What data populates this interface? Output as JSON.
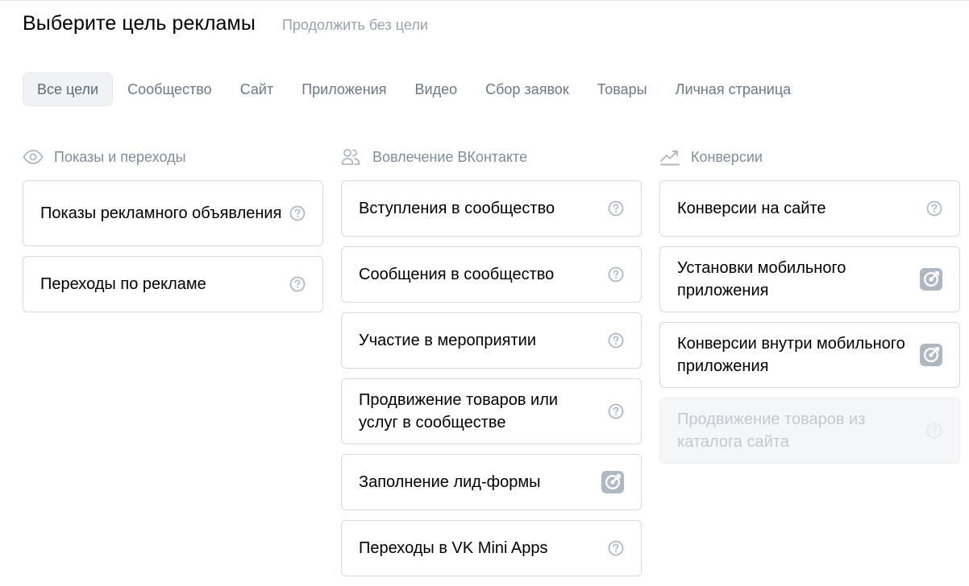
{
  "header": {
    "title": "Выберите цель рекламы",
    "skip_link": "Продолжить без цели"
  },
  "tabs": [
    {
      "label": "Все цели",
      "active": true
    },
    {
      "label": "Сообщество",
      "active": false
    },
    {
      "label": "Сайт",
      "active": false
    },
    {
      "label": "Приложения",
      "active": false
    },
    {
      "label": "Видео",
      "active": false
    },
    {
      "label": "Сбор заявок",
      "active": false
    },
    {
      "label": "Товары",
      "active": false
    },
    {
      "label": "Личная страница",
      "active": false
    }
  ],
  "columns": [
    {
      "title": "Показы и переходы",
      "icon": "eye-icon",
      "cards": [
        {
          "label": "Показы рекламного объявления",
          "badge": "question-circle-icon",
          "disabled": false
        },
        {
          "label": "Переходы по рекламе",
          "badge": "question-circle-icon",
          "disabled": false
        }
      ]
    },
    {
      "title": "Вовлечение ВКонтакте",
      "icon": "users-icon",
      "cards": [
        {
          "label": "Вступления в сообщество",
          "badge": "question-circle-icon",
          "disabled": false
        },
        {
          "label": "Сообщения в сообщество",
          "badge": "question-circle-icon",
          "disabled": false
        },
        {
          "label": "Участие в мероприятии",
          "badge": "question-circle-icon",
          "disabled": false
        },
        {
          "label": "Продвижение товаров или услуг в сообществе",
          "badge": "question-circle-icon",
          "disabled": false
        },
        {
          "label": "Заполнение лид-формы",
          "badge": "target-badge-icon",
          "disabled": false
        },
        {
          "label": "Переходы в VK Mini Apps",
          "badge": "question-circle-icon",
          "disabled": false
        }
      ]
    },
    {
      "title": "Конверсии",
      "icon": "trend-up-icon",
      "cards": [
        {
          "label": "Конверсии на сайте",
          "badge": "question-circle-icon",
          "disabled": false
        },
        {
          "label": "Установки мобильного приложения",
          "badge": "target-badge-icon",
          "disabled": false
        },
        {
          "label": "Конверсии внутри мобильного приложения",
          "badge": "target-badge-icon",
          "disabled": false
        },
        {
          "label": "Продвижение товаров из каталога сайта",
          "badge": "question-circle-icon",
          "disabled": true
        }
      ]
    }
  ],
  "colors": {
    "muted_text": "#818c99",
    "icon_gray": "#aeb7c2",
    "card_border": "#d7d8db"
  }
}
